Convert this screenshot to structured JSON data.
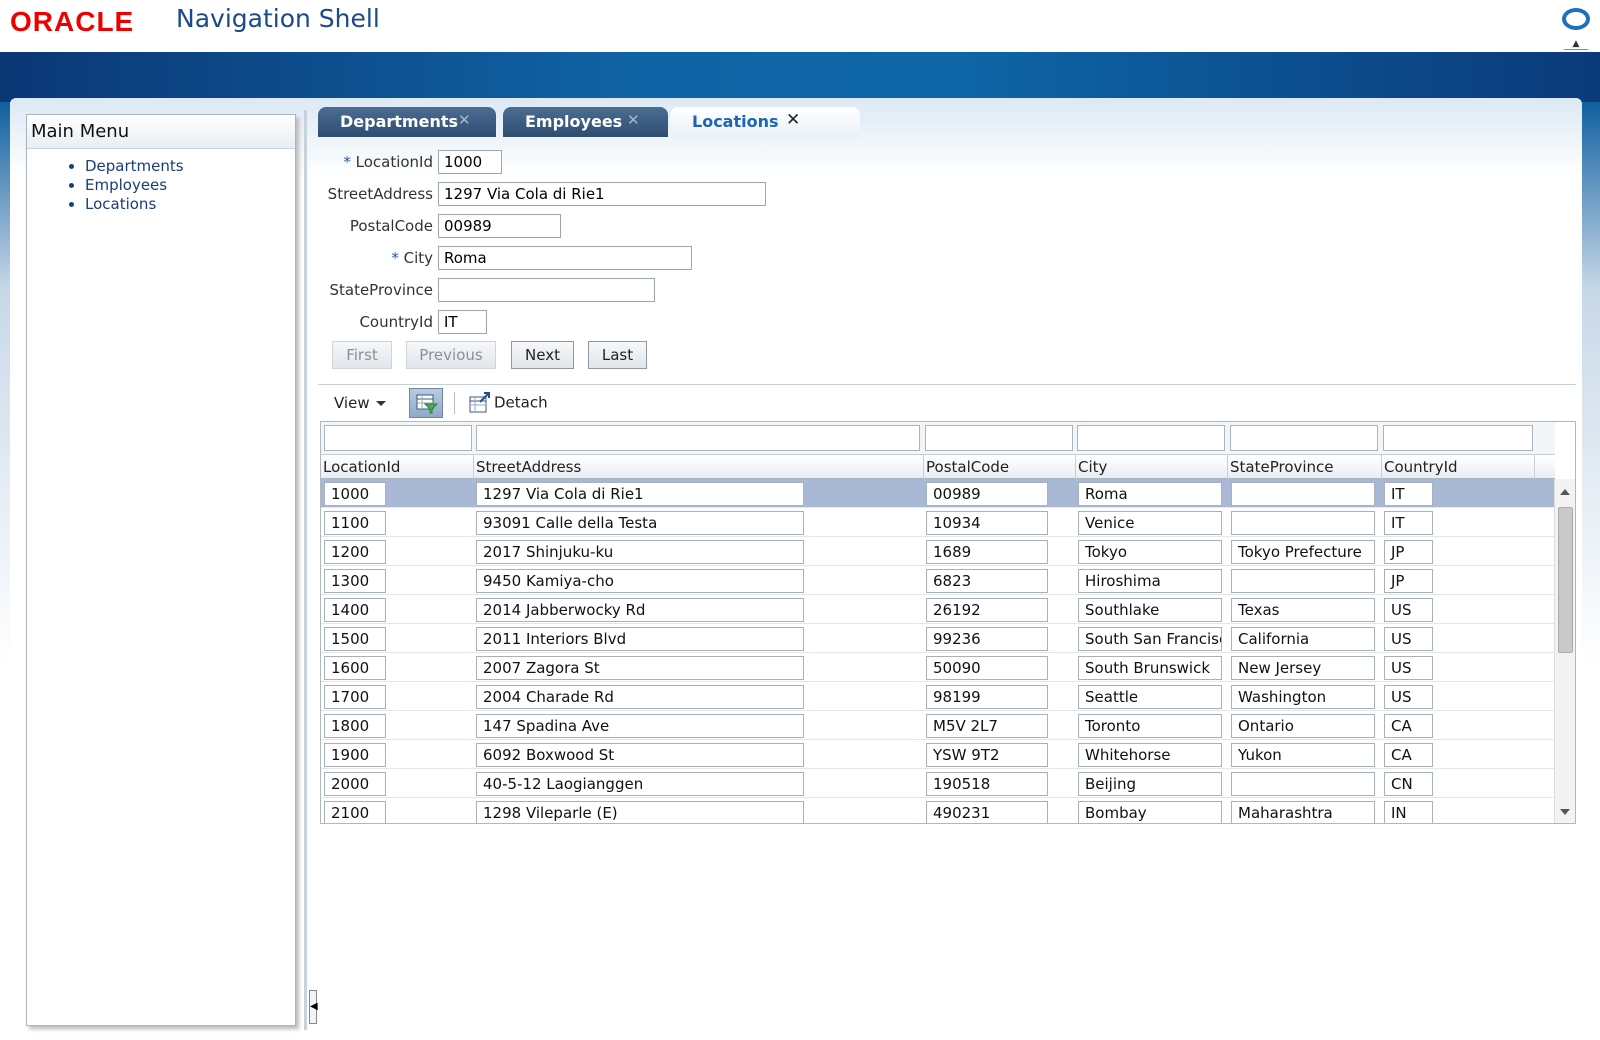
{
  "header": {
    "logo": "ORACLE",
    "title": "Navigation Shell"
  },
  "sidebar": {
    "title": "Main Menu",
    "items": [
      "Departments",
      "Employees",
      "Locations"
    ]
  },
  "tabs": [
    {
      "label": "Departments",
      "active": false
    },
    {
      "label": "Employees",
      "active": false
    },
    {
      "label": "Locations",
      "active": true
    }
  ],
  "tab_close_glyph": "✕",
  "form": {
    "location_id": {
      "label": "LocationId",
      "required": true,
      "value": "1000"
    },
    "street_address": {
      "label": "StreetAddress",
      "required": false,
      "value": "1297 Via Cola di Rie1"
    },
    "postal_code": {
      "label": "PostalCode",
      "required": false,
      "value": "00989"
    },
    "city": {
      "label": "City",
      "required": true,
      "value": "Roma"
    },
    "state_province": {
      "label": "StateProvince",
      "required": false,
      "value": ""
    },
    "country_id": {
      "label": "CountryId",
      "required": false,
      "value": "IT"
    },
    "required_marker": "*"
  },
  "navigation": {
    "first": "First",
    "previous": "Previous",
    "next": "Next",
    "last": "Last"
  },
  "toolbar": {
    "view_label": "View",
    "detach_label": "Detach"
  },
  "table": {
    "columns": [
      "LocationId",
      "StreetAddress",
      "PostalCode",
      "City",
      "StateProvince",
      "CountryId"
    ],
    "rows": [
      [
        "1000",
        "1297 Via Cola di Rie1",
        "00989",
        "Roma",
        "",
        "IT"
      ],
      [
        "1100",
        "93091 Calle della Testa",
        "10934",
        "Venice",
        "",
        "IT"
      ],
      [
        "1200",
        "2017 Shinjuku-ku",
        "1689",
        "Tokyo",
        "Tokyo Prefecture",
        "JP"
      ],
      [
        "1300",
        "9450 Kamiya-cho",
        "6823",
        "Hiroshima",
        "",
        "JP"
      ],
      [
        "1400",
        "2014 Jabberwocky Rd",
        "26192",
        "Southlake",
        "Texas",
        "US"
      ],
      [
        "1500",
        "2011 Interiors Blvd",
        "99236",
        "South San Francisc",
        "California",
        "US"
      ],
      [
        "1600",
        "2007 Zagora St",
        "50090",
        "South Brunswick",
        "New Jersey",
        "US"
      ],
      [
        "1700",
        "2004 Charade Rd",
        "98199",
        "Seattle",
        "Washington",
        "US"
      ],
      [
        "1800",
        "147 Spadina Ave",
        "M5V 2L7",
        "Toronto",
        "Ontario",
        "CA"
      ],
      [
        "1900",
        "6092 Boxwood St",
        "YSW 9T2",
        "Whitehorse",
        "Yukon",
        "CA"
      ],
      [
        "2000",
        "40-5-12 Laogianggen",
        "190518",
        "Beijing",
        "",
        "CN"
      ],
      [
        "2100",
        "1298 Vileparle (E)",
        "490231",
        "Bombay",
        "Maharashtra",
        "IN"
      ]
    ],
    "selected_row": 0
  },
  "colors": {
    "brand_red": "#e00000",
    "title_blue": "#1b4a8a",
    "band_blue": "#0e5a9c",
    "selected_row": "#a8b8d5",
    "tab_dark": "#304e74"
  }
}
